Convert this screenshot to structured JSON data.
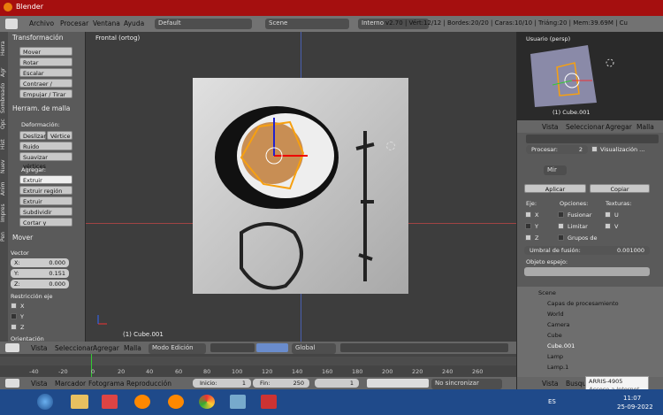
{
  "window": {
    "title": "Blender"
  },
  "topbar": {
    "menus": [
      "Archivo",
      "Procesar",
      "Ventana",
      "Ayuda"
    ],
    "layout": "Default",
    "scene": "Scene",
    "engine": "Interno",
    "stats": "v2.70 | Vért:12/12 | Bordes:20/20 | Caras:10/10 | Triáng:20 | Mem:39.69M | Cu"
  },
  "left_tabs": [
    "Herra",
    "Agr",
    "Sombreado",
    "Opc",
    "Hist",
    "Nuev",
    "Anim",
    "Impres",
    "Pen"
  ],
  "left": {
    "transform_header": "Transformación",
    "transform_buttons": [
      "Mover",
      "Rotar",
      "Escalar",
      "Contraer / Expan...",
      "Empujar / Tirar"
    ],
    "mesh_header": "Herram. de malla",
    "deform_label": "Deformación:",
    "slide_buttons": [
      "Deslizar",
      "Vértice"
    ],
    "noise": "Ruido",
    "smooth": "Suavizar vértices",
    "add_label": "Agregar:",
    "add_items": [
      "Extruir",
      "Extruir región",
      "Extruir individual",
      "Subdividir",
      "Cortar y deslizar..."
    ],
    "move_header": "Mover",
    "vector_label": "Vector",
    "vector": [
      {
        "k": "X:",
        "v": "0.000"
      },
      {
        "k": "Y:",
        "v": "0.151"
      },
      {
        "k": "Z:",
        "v": "0.000"
      }
    ],
    "axis_label": "Restricción eje",
    "axes": [
      "X",
      "Y",
      "Z"
    ],
    "orient_label": "Orientación"
  },
  "viewport": {
    "view_label": "Frontal (ortog)",
    "object_label": "(1) Cube.001"
  },
  "vp_bottom": {
    "items": [
      "Vista",
      "Seleccionar",
      "Agregar",
      "Malla"
    ],
    "mode": "Modo Edición",
    "orientation": "Global"
  },
  "timeline": {
    "ticks": [
      "-40",
      "-20",
      "0",
      "20",
      "40",
      "60",
      "80",
      "100",
      "120",
      "140",
      "160",
      "180",
      "200",
      "220",
      "240",
      "260"
    ]
  },
  "tl_bottom": {
    "items": [
      "Vista",
      "Marcador",
      "Fotograma",
      "Reproducción"
    ],
    "start": "Inicio:",
    "start_v": "1",
    "end": "Fin:",
    "end_v": "250",
    "frame": "1",
    "sync": "No sincronizar"
  },
  "right": {
    "mini_label": "Usuario (persp)",
    "mini_object": "(1) Cube.001",
    "mini_menus": [
      "Vista",
      "Seleccionar",
      "Agregar",
      "Malla"
    ],
    "process_label": "Procesar:",
    "process_v": "2",
    "visual_label": "Visualización ...",
    "mod_name": "Mir",
    "apply": "Aplicar",
    "copy": "Copiar",
    "axis_h": "Eje:",
    "options_h": "Opciones:",
    "textures_h": "Texturas:",
    "opt_rows": [
      {
        "ax": "X",
        "opt": "Fusionar",
        "tex": "U"
      },
      {
        "ax": "Y",
        "opt": "Limitar",
        "tex": "V"
      },
      {
        "ax": "Z",
        "opt": "Grupos de",
        "tex": ""
      }
    ],
    "merge_label": "Umbral de fusión:",
    "merge_v": "0.001000",
    "mirror_obj": "Objeto espejo:",
    "outliner": [
      "Scene",
      "Capas de procesamiento",
      "World",
      "Camera",
      "Cube",
      "Cube.001",
      "Lamp",
      "Lamp.1"
    ],
    "bottom_items": [
      "Vista",
      "Busque"
    ]
  },
  "tooltip": {
    "title": "ARRIS-4905",
    "sub": "Acceso a Internet"
  },
  "taskbar": {
    "lang": "ES",
    "time": "11:07",
    "date": "25-09-2022"
  }
}
